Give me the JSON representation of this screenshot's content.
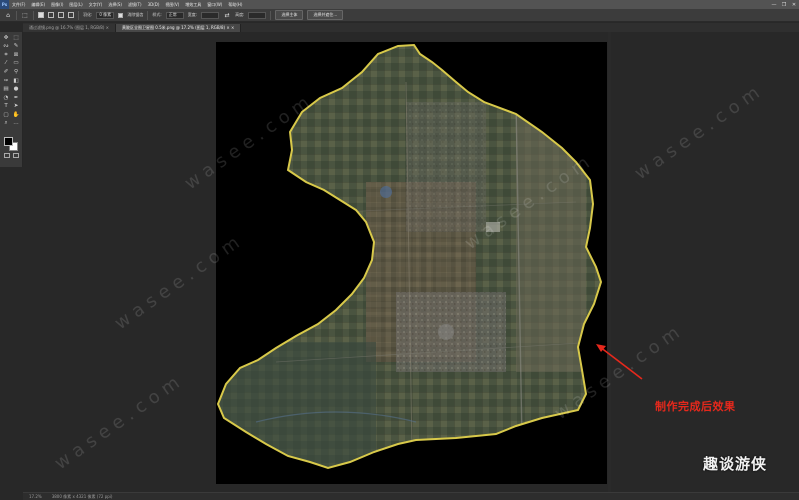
{
  "menubar": {
    "logo": "Ps",
    "items": [
      "文件(F)",
      "编辑(E)",
      "图像(I)",
      "图层(L)",
      "文字(Y)",
      "选择(S)",
      "滤镜(T)",
      "3D(D)",
      "视图(V)",
      "增效工具",
      "窗口(W)",
      "帮助(H)"
    ],
    "window_controls": [
      "—",
      "❐",
      "✕"
    ]
  },
  "options_bar": {
    "feather_label": "羽化:",
    "feather_value": "0 像素",
    "antialias_label": "消除锯齿",
    "style_label": "样式:",
    "style_value": "正常",
    "width_label": "宽度:",
    "height_label": "高度:",
    "select_subject_button": "选择主体",
    "select_mask_button": "选择并遮住..."
  },
  "tabs": [
    {
      "label": "通过滤镜.png @ 16.7% (图层 1, RGB/8) ×",
      "active": false
    },
    {
      "label": "黄陂区全图卫星图 0.5米.png @ 17.2% (图层 1, RGB/8) × ×",
      "active": true
    }
  ],
  "tools": [
    {
      "icon": "move-tool-icon",
      "glyph": "✥"
    },
    {
      "icon": "marquee-tool-icon",
      "glyph": "⬚"
    },
    {
      "icon": "lasso-tool-icon",
      "glyph": "ᔓ"
    },
    {
      "icon": "quick-select-tool-icon",
      "glyph": "✎"
    },
    {
      "icon": "crop-tool-icon",
      "glyph": "⌗"
    },
    {
      "icon": "frame-tool-icon",
      "glyph": "⊠"
    },
    {
      "icon": "eyedropper-tool-icon",
      "glyph": "⁄"
    },
    {
      "icon": "healing-brush-tool-icon",
      "glyph": "▭"
    },
    {
      "icon": "brush-tool-icon",
      "glyph": "✐"
    },
    {
      "icon": "clone-stamp-tool-icon",
      "glyph": "⚲"
    },
    {
      "icon": "history-brush-tool-icon",
      "glyph": "✑"
    },
    {
      "icon": "eraser-tool-icon",
      "glyph": "◧"
    },
    {
      "icon": "gradient-tool-icon",
      "glyph": "▤"
    },
    {
      "icon": "blur-tool-icon",
      "glyph": "●"
    },
    {
      "icon": "dodge-tool-icon",
      "glyph": "◔"
    },
    {
      "icon": "pen-tool-icon",
      "glyph": "✒"
    },
    {
      "icon": "type-tool-icon",
      "glyph": "T"
    },
    {
      "icon": "path-select-tool-icon",
      "glyph": "➤"
    },
    {
      "icon": "rectangle-tool-icon",
      "glyph": "▢"
    },
    {
      "icon": "hand-tool-icon",
      "glyph": "✋"
    },
    {
      "icon": "zoom-tool-icon",
      "glyph": "⌕"
    },
    {
      "icon": "more-tools-icon",
      "glyph": "…"
    }
  ],
  "colors": {
    "foreground": "#000000",
    "background": "#ffffff",
    "boundary": "#d8c94a",
    "annotation": "#e6281c"
  },
  "status_bar": {
    "zoom": "17.2%",
    "info": "3800 像素 x 4321 像素 (72 ppi)"
  },
  "annotation": {
    "text": "制作完成后效果"
  },
  "watermark": {
    "text": "w a s e e . c o m"
  },
  "site_logo": {
    "text": "趣谈游侠"
  }
}
